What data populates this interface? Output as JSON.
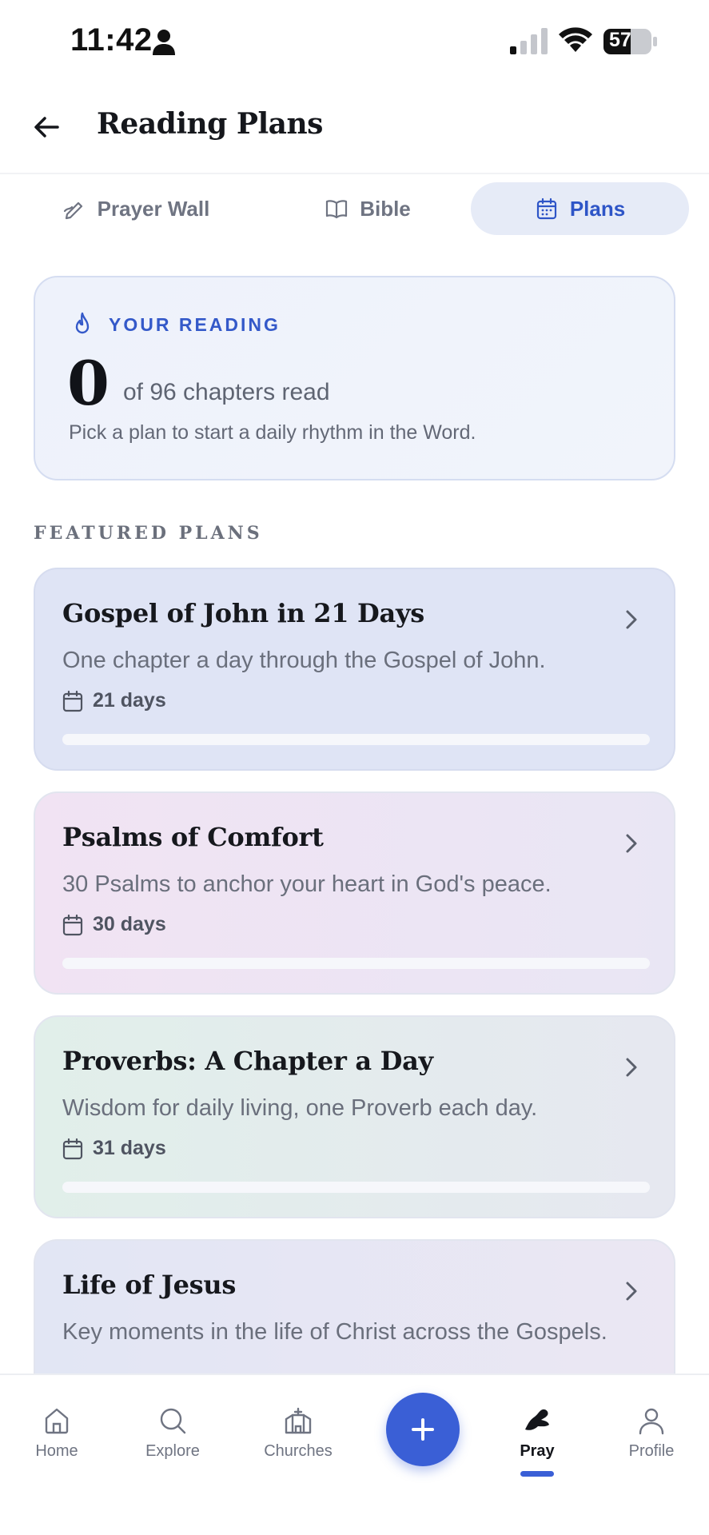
{
  "status_bar": {
    "time": "11:42",
    "battery": "57"
  },
  "header": {
    "title": "Reading Plans"
  },
  "tabs": [
    {
      "label": "Prayer Wall",
      "icon": "pen-hand-icon",
      "active": false
    },
    {
      "label": "Bible",
      "icon": "book-open-icon",
      "active": false
    },
    {
      "label": "Plans",
      "icon": "calendar-icon",
      "active": true
    }
  ],
  "reading_card": {
    "label": "YOUR READING",
    "count": "0",
    "of_text": "of 96 chapters read",
    "subtitle": "Pick a plan to start a daily rhythm in the Word."
  },
  "featured": {
    "label": "FEATURED PLANS",
    "plans": [
      {
        "title": "Gospel of John in 21 Days",
        "description": "One chapter a day through the Gospel of John.",
        "duration": "21 days",
        "progress": 0
      },
      {
        "title": "Psalms of Comfort",
        "description": "30 Psalms to anchor your heart in God's peace.",
        "duration": "30 days",
        "progress": 0
      },
      {
        "title": "Proverbs: A Chapter a Day",
        "description": "Wisdom for daily living, one Proverb each day.",
        "duration": "31 days",
        "progress": 0
      },
      {
        "title": "Life of Jesus",
        "description": "Key moments in the life of Christ across the Gospels."
      }
    ]
  },
  "bottom_nav": {
    "items": [
      {
        "label": "Home",
        "icon": "home-icon"
      },
      {
        "label": "Explore",
        "icon": "search-icon"
      },
      {
        "label": "Churches",
        "icon": "church-icon"
      },
      {
        "label": "Pray",
        "icon": "praying-hands-icon",
        "active": true
      },
      {
        "label": "Profile",
        "icon": "person-icon"
      }
    ],
    "fab_icon": "plus-icon"
  },
  "colors": {
    "accent": "#3a5fd6",
    "active_tab_bg": "#e6ebf7",
    "active_tab_text": "#2e55c7"
  }
}
